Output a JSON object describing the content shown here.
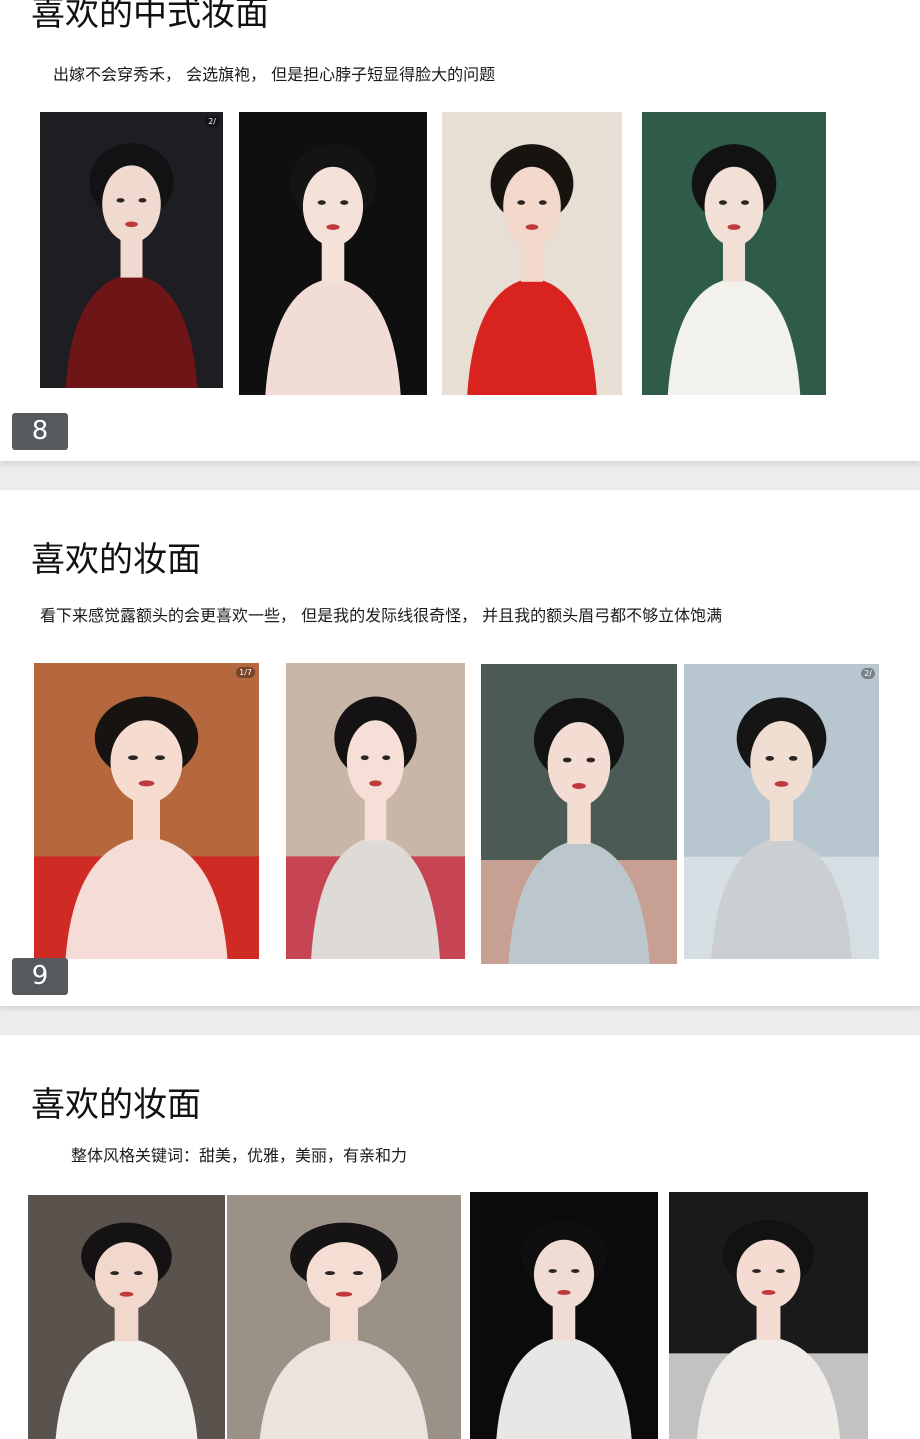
{
  "sections": [
    {
      "title": "喜欢的中式妆面",
      "subtitle": "出嫁不会穿秀禾， 会选旗袍， 但是担心脖子短显得脸大的问题",
      "page_number": "8",
      "photos": [
        {
          "label": "side-profile-red-qipao",
          "counter": "2/",
          "colors": {
            "bg": "#1e1e22",
            "dress": "#6e1518",
            "skin": "#f0d9cf",
            "hair": "#121214"
          }
        },
        {
          "label": "front-portrait-pink-collar",
          "colors": {
            "bg": "#0f0f10",
            "dress": "#f1dcd6",
            "skin": "#f4e2d8",
            "hair": "#141414"
          }
        },
        {
          "label": "red-lace-qipao-standing",
          "colors": {
            "bg": "#e8dfd4",
            "dress": "#d8231f",
            "skin": "#f3d9cc",
            "hair": "#17130f"
          }
        },
        {
          "label": "white-dress-by-water",
          "colors": {
            "bg": "#2f5c49",
            "dress": "#f3f1ec",
            "skin": "#f2e0d6",
            "hair": "#121212"
          }
        }
      ]
    },
    {
      "title": "喜欢的妆面",
      "subtitle": "看下来感觉露额头的会更喜欢一些， 但是我的发际线很奇怪， 并且我的额头眉弓都不够立体饱满",
      "page_number": "9",
      "photos": [
        {
          "label": "pink-qipao-on-red-bed",
          "counter": "1/7",
          "colors": {
            "bg": "#b5683e",
            "dress": "#f6dcd6",
            "skin": "#f5dccf",
            "hair": "#171310",
            "accent": "#d8151c"
          }
        },
        {
          "label": "embroidered-white-jacket",
          "colors": {
            "bg": "#c9b6a6",
            "dress": "#dedad6",
            "skin": "#f5dfd6",
            "hair": "#141212",
            "accent": "#c41e37"
          }
        },
        {
          "label": "pale-blue-qipao-portrait",
          "colors": {
            "bg": "#4b5a55",
            "dress": "#bcc7cd",
            "skin": "#f3dcd1",
            "hair": "#121212",
            "accent": "#f2b8a8"
          }
        },
        {
          "label": "grey-qipao-harbour",
          "counter": "2/",
          "colors": {
            "bg": "#b8c6cf",
            "dress": "#cbcfd2",
            "skin": "#f1ded3",
            "hair": "#151515",
            "accent": "#dfe6ea"
          }
        }
      ]
    },
    {
      "title": "喜欢的妆面",
      "subtitle": "整体风格关键词：甜美，优雅，美丽，有亲和力",
      "photos": [
        {
          "label": "braided-hair-white-top",
          "colors": {
            "bg": "#5a524c",
            "dress": "#f1efec",
            "skin": "#f2d8cc",
            "hair": "#141212"
          }
        },
        {
          "label": "sheer-white-top-portrait",
          "colors": {
            "bg": "#9c9186",
            "dress": "#ece3de",
            "skin": "#f4ddd2",
            "hair": "#151313"
          }
        },
        {
          "label": "pearl-necklace-black-bg",
          "colors": {
            "bg": "#0b0b0c",
            "dress": "#e9e7e6",
            "skin": "#f0dcd3",
            "hair": "#0f0f10"
          }
        },
        {
          "label": "floral-crown-veil",
          "colors": {
            "bg": "#1a1a1c",
            "dress": "#f0ece8",
            "skin": "#f4dcd2",
            "hair": "#121212",
            "accent": "#fbfbfb"
          }
        }
      ]
    }
  ]
}
